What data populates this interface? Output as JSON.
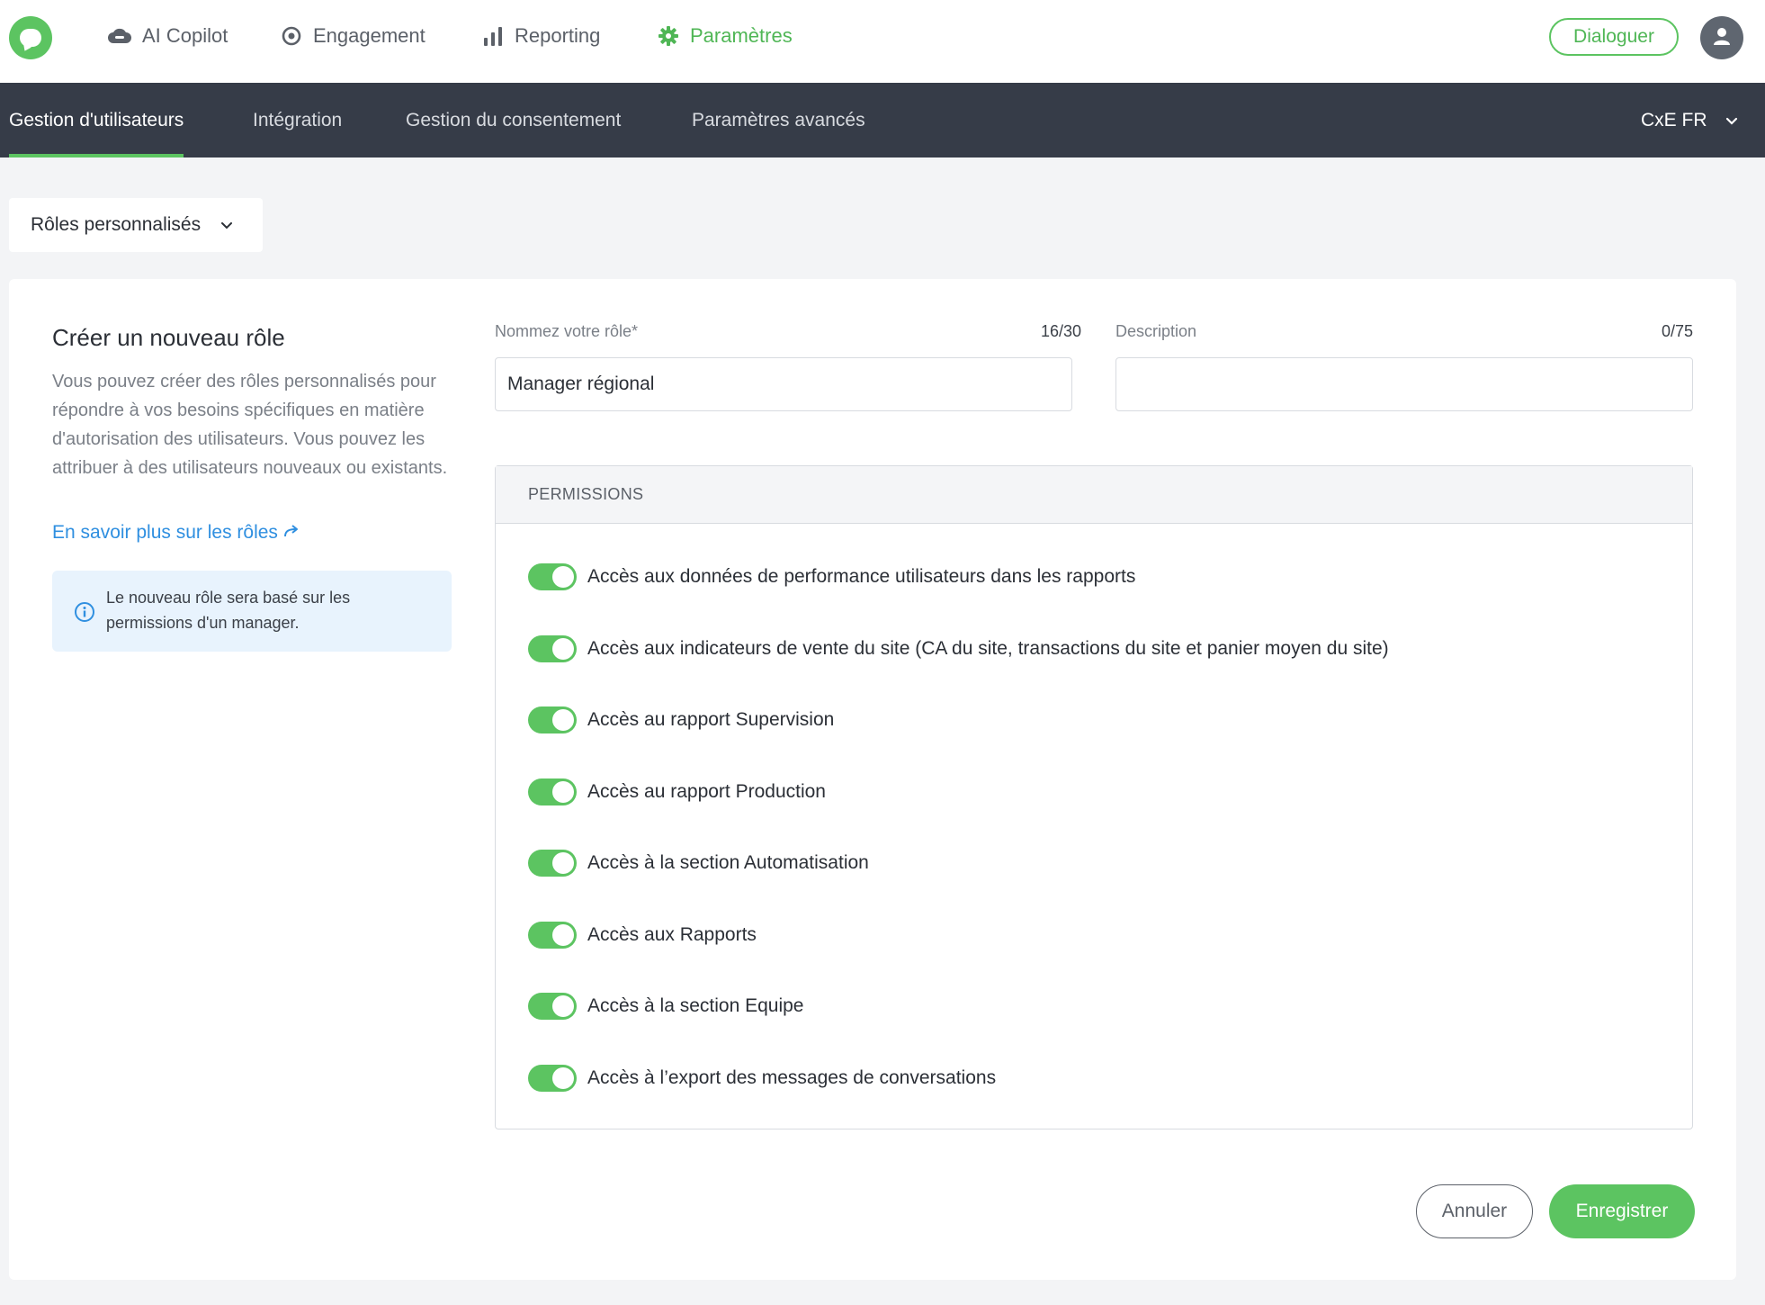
{
  "topnav": {
    "items": [
      {
        "label": "AI Copilot",
        "icon": "cloud-icon"
      },
      {
        "label": "Engagement",
        "icon": "target-icon"
      },
      {
        "label": "Reporting",
        "icon": "bar-chart-icon"
      },
      {
        "label": "Paramètres",
        "icon": "gear-icon",
        "active": true
      }
    ],
    "dialog_button": "Dialoguer"
  },
  "subnav": {
    "items": [
      {
        "label": "Gestion d'utilisateurs",
        "active": true
      },
      {
        "label": "Intégration"
      },
      {
        "label": "Gestion du consentement"
      },
      {
        "label": "Paramètres avancés"
      }
    ],
    "org": "CxE FR"
  },
  "roles_dropdown": {
    "label": "Rôles personnalisés"
  },
  "card": {
    "title": "Créer un nouveau rôle",
    "description": "Vous pouvez créer des rôles personnalisés pour répondre à vos besoins spécifiques en matière d'autorisation des utilisateurs. Vous pouvez les attribuer à des utilisateurs nouveaux ou existants.",
    "learn_link": "En savoir plus sur les rôles",
    "info": "Le nouveau rôle sera basé sur les permissions d'un manager."
  },
  "form": {
    "name_label": "Nommez votre rôle*",
    "name_count": "16/30",
    "name_value": "Manager régional",
    "description_label": "Description",
    "description_count": "0/75",
    "description_value": ""
  },
  "permissions": {
    "header": "PERMISSIONS",
    "items": [
      {
        "label": "Accès aux données de performance utilisateurs dans les rapports",
        "enabled": true
      },
      {
        "label": "Accès aux indicateurs de vente du site (CA du site, transactions du site et panier moyen du site)",
        "enabled": true
      },
      {
        "label": "Accès au rapport Supervision",
        "enabled": true
      },
      {
        "label": "Accès au rapport Production",
        "enabled": true
      },
      {
        "label": "Accès à la section Automatisation",
        "enabled": true
      },
      {
        "label": "Accès aux Rapports",
        "enabled": true
      },
      {
        "label": "Accès à la section Equipe",
        "enabled": true
      },
      {
        "label": "Accès à l’export des messages de conversations",
        "enabled": true
      }
    ]
  },
  "actions": {
    "cancel": "Annuler",
    "save": "Enregistrer"
  },
  "colors": {
    "brand_green": "#5cc461",
    "subnav_bg": "#363c48",
    "link_blue": "#2f8fe0",
    "info_bg": "#e8f3fd"
  }
}
